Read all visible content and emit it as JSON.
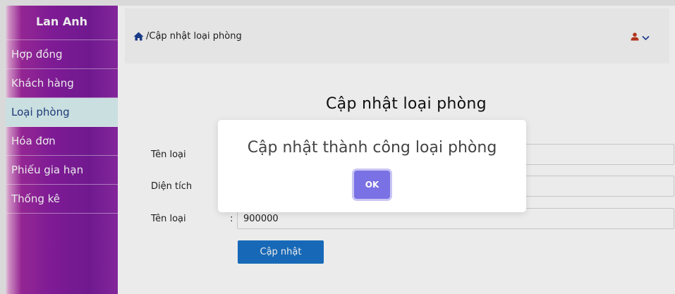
{
  "sidebar": {
    "brand": "Lan Anh",
    "items": [
      {
        "label": "Hợp đồng"
      },
      {
        "label": "Khách hàng"
      },
      {
        "label": "Loại phòng"
      },
      {
        "label": "Hóa đơn"
      },
      {
        "label": "Phiếu gia hạn"
      },
      {
        "label": "Thống kê"
      }
    ]
  },
  "header": {
    "breadcrumb": "/Cập nhật loại phòng",
    "home_icon": "home-icon",
    "user_icon": "user-icon",
    "chevron_icon": "chevron-down-icon"
  },
  "form": {
    "title": "Cập nhật loại phòng",
    "fields": [
      {
        "label": "Tên loại",
        "colon": ":",
        "value": ""
      },
      {
        "label": "Diện tích",
        "colon": ":",
        "value": ""
      },
      {
        "label": "Tên loại",
        "colon": ":",
        "value": "900000"
      }
    ],
    "submit_label": "Cập nhật"
  },
  "modal": {
    "message": "Cập nhật thành công loại phòng",
    "ok_label": "OK"
  },
  "colors": {
    "accent": "#1a72c7",
    "ok_button": "#7a71e4",
    "sidebar": "#7a1c9c",
    "icon": "#c0391e",
    "active_item": "#dcf2f3"
  }
}
